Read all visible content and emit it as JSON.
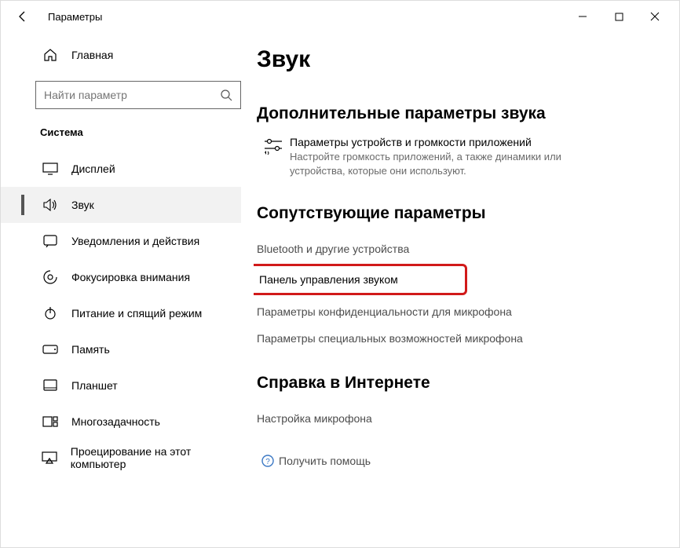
{
  "window": {
    "title": "Параметры"
  },
  "sidebar": {
    "home_label": "Главная",
    "search_placeholder": "Найти параметр",
    "category": "Система",
    "items": [
      {
        "label": "Дисплей"
      },
      {
        "label": "Звук"
      },
      {
        "label": "Уведомления и действия"
      },
      {
        "label": "Фокусировка внимания"
      },
      {
        "label": "Питание и спящий режим"
      },
      {
        "label": "Память"
      },
      {
        "label": "Планшет"
      },
      {
        "label": "Многозадачность"
      },
      {
        "label": "Проецирование на этот компьютер"
      }
    ]
  },
  "main": {
    "title": "Звук",
    "advanced_header": "Дополнительные параметры звука",
    "app_volume_title": "Параметры устройств и громкости приложений",
    "app_volume_desc": "Настройте громкость приложений, а также динамики или устройства, которые они используют.",
    "related_header": "Сопутствующие параметры",
    "related_links": [
      "Bluetooth и другие устройства",
      "Панель управления звуком",
      "Параметры конфиденциальности для микрофона",
      "Параметры специальных возможностей микрофона"
    ],
    "help_header": "Справка в Интернете",
    "help_links": [
      "Настройка микрофона"
    ],
    "get_help_label": "Получить помощь"
  }
}
